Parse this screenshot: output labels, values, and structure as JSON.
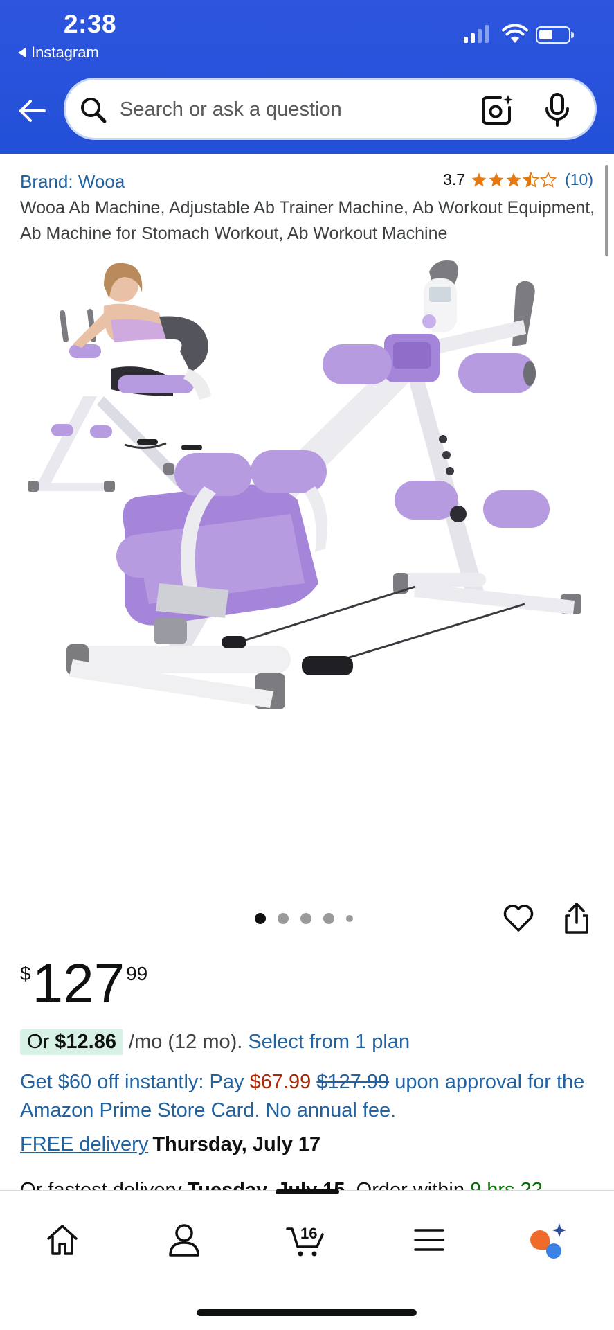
{
  "status_bar": {
    "time": "2:38",
    "back_app": "Instagram"
  },
  "search": {
    "placeholder": "Search or ask a question",
    "icons": [
      "back-arrow-icon",
      "search-icon",
      "camera-icon",
      "mic-icon"
    ]
  },
  "product": {
    "brand_label": "Brand: Wooa",
    "rating": "3.7",
    "rating_stars": 3.7,
    "review_count": "(10)",
    "title": "Wooa Ab Machine, Adjustable Ab Trainer Machine, Ab Workout Equipment, Ab Machine for Stomach Workout, Ab Workout Machine",
    "image_alt": "Purple and white adjustable ab trainer machine with inset of woman using it",
    "gallery_count": 5,
    "gallery_active": 1,
    "accent_color": "#b69be0"
  },
  "price": {
    "currency": "$",
    "whole": "127",
    "fraction": "99"
  },
  "installment": {
    "or": "Or",
    "amount": "$12.86",
    "per": "/mo (12 mo).",
    "link": "Select from 1 plan"
  },
  "offer": {
    "lead": "Get $60 off instantly: Pay",
    "discount_price": "$67.99",
    "original_price": "$127.99",
    "tail": "upon approval for the Amazon Prime Store Card. No annual fee."
  },
  "delivery": {
    "free_label": "FREE delivery",
    "date": "Thursday, July 17"
  },
  "fastest": {
    "lead": "Or fastest delivery",
    "date": "Tuesday, July 15",
    "mid": ". Order within",
    "countdown": "9 hrs 22"
  },
  "bottom_nav": {
    "cart_count": "16",
    "items": [
      "home-icon",
      "account-icon",
      "cart-icon",
      "menu-icon",
      "rufus-icon"
    ]
  },
  "colors": {
    "header_blue": "#2350d8",
    "link_blue": "#2162a1",
    "price_red": "#b12704",
    "star_orange": "#e47911",
    "deal_green": "#007600"
  }
}
